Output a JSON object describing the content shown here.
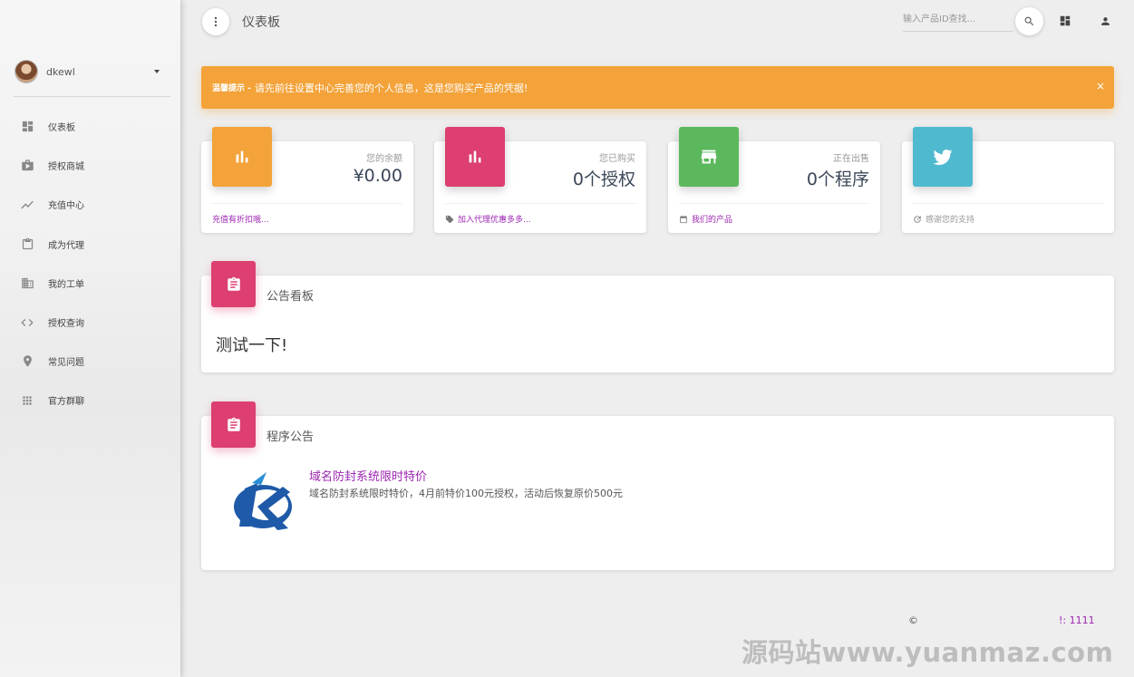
{
  "sidebar": {
    "user": {
      "name": "dkewl"
    },
    "items": [
      {
        "label": "仪表板",
        "icon": "dashboard-icon"
      },
      {
        "label": "授权商城",
        "icon": "shop-icon"
      },
      {
        "label": "充值中心",
        "icon": "trending-icon"
      },
      {
        "label": "成为代理",
        "icon": "clipboard-icon"
      },
      {
        "label": "我的工单",
        "icon": "building-icon"
      },
      {
        "label": "授权查询",
        "icon": "code-icon"
      },
      {
        "label": "常见问题",
        "icon": "location-icon"
      },
      {
        "label": "官方群聊",
        "icon": "apps-icon"
      }
    ]
  },
  "header": {
    "title": "仪表板",
    "search_placeholder": "输入产品ID查找..."
  },
  "alert": {
    "strong": "温馨提示 -",
    "text": "请先前往设置中心完善您的个人信息，这是您购买产品的凭据!",
    "close": "×"
  },
  "stats": [
    {
      "category": "您的余额",
      "value": "¥0.00",
      "footer": "充值有折扣哦...",
      "color": "#f3a33a",
      "icon": "bar-chart-icon"
    },
    {
      "category": "您已购买",
      "value": "0个授权",
      "footer": "加入代理优惠多多...",
      "color": "#dc3f70",
      "icon": "bar-chart-icon"
    },
    {
      "category": "正在出售",
      "value": "0个程序",
      "footer": "我们的产品",
      "color": "#5cb85c",
      "icon": "store-icon"
    },
    {
      "category": "",
      "value": "",
      "footer": "感谢您的支持",
      "color": "#4fb9cf",
      "icon": "twitter-icon"
    }
  ],
  "notice": {
    "title": "公告看板",
    "body": "测试一下!"
  },
  "program": {
    "title": "程序公告",
    "items": [
      {
        "title": "域名防封系统限时特价",
        "desc": "域名防封系统限时特价，4月前特价100元授权，活动后恢复原价500元"
      }
    ]
  },
  "footer": {
    "copyright": "©",
    "suffix": "!: 1111"
  },
  "watermark": "源码站www.yuanmaz.com",
  "colors": {
    "accent_purple": "#9c27b0",
    "alert_orange": "#f3a33a",
    "pink": "#dc3f70",
    "green": "#5cb85c",
    "cyan": "#4fb9cf"
  }
}
